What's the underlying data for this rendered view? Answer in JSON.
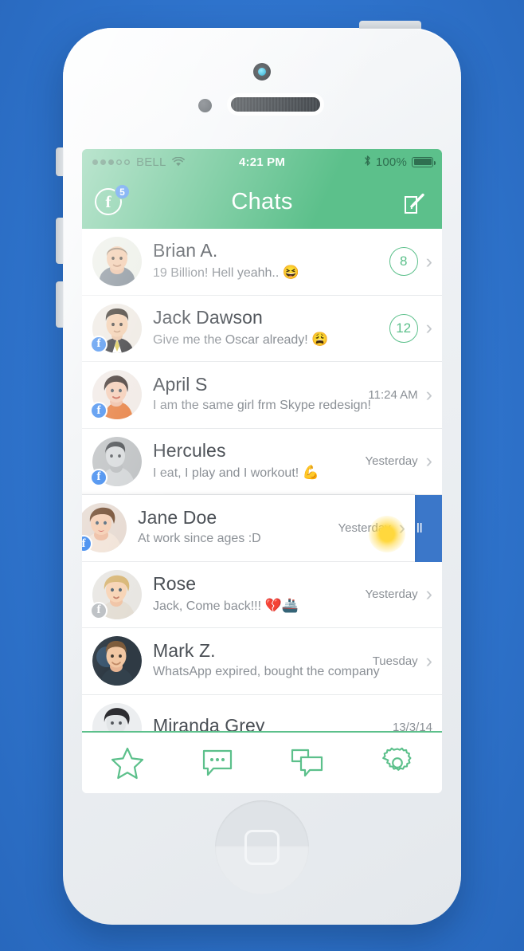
{
  "background": {
    "color": "#3176cf"
  },
  "device": {
    "name": "white-smartphone",
    "camera_lens_color": "#14a9cf",
    "body_color": "#eef1f4"
  },
  "theme": {
    "accent_green": "#5cc08b",
    "badge_blue": "#2f80ed",
    "action_blue": "#3b77c9",
    "text_primary": "#4a4f55",
    "text_secondary": "#8b9096"
  },
  "status_bar": {
    "signal_dots_filled": 3,
    "signal_dots_total": 5,
    "carrier": "BELL",
    "wifi_icon": "wifi-icon",
    "time": "4:21 PM",
    "bluetooth_icon": "bluetooth-icon",
    "battery_percent": "100%",
    "battery_icon": "battery-full-icon"
  },
  "nav_bar": {
    "facebook_button": {
      "icon": "facebook-icon",
      "glyph": "f",
      "count": "5"
    },
    "title": "Chats",
    "compose_button": {
      "icon": "compose-pencil-icon",
      "label": "Compose"
    }
  },
  "chats": [
    {
      "name": "Brian A.",
      "message": "19 Billion! Hell yeahh..",
      "emoji": "😆",
      "time": "",
      "unread": "8",
      "facebook_tag": "none",
      "avatar": "brian-avatar",
      "slid": false
    },
    {
      "name": "Jack Dawson",
      "message": "Give me the Oscar already!",
      "emoji": "😩",
      "time": "",
      "unread": "12",
      "facebook_tag": "blue",
      "avatar": "jack-avatar",
      "slid": false
    },
    {
      "name": "April S",
      "message": "I am the same girl frm Skype redesign!",
      "emoji": "",
      "time": "11:24 AM",
      "unread": "",
      "facebook_tag": "blue",
      "avatar": "april-avatar",
      "slid": false
    },
    {
      "name": "Hercules",
      "message": "I eat, I play and I workout!",
      "emoji": "💪",
      "time": "Yesterday",
      "unread": "",
      "facebook_tag": "blue",
      "avatar": "hercules-avatar",
      "slid": false
    },
    {
      "name": "Jane Doe",
      "message": "At work since ages :D",
      "emoji": "",
      "time": "Yesterday",
      "unread": "",
      "facebook_tag": "blue",
      "avatar": "jane-avatar",
      "slid": true,
      "action_label": "ll"
    },
    {
      "name": "Rose",
      "message": "Jack, Come back!!!",
      "emoji": "💔🚢",
      "time": "Yesterday",
      "unread": "",
      "facebook_tag": "grey",
      "avatar": "rose-avatar",
      "slid": false
    },
    {
      "name": "Mark Z.",
      "message": "WhatsApp expired, bought the company",
      "emoji": "",
      "time": "Tuesday",
      "unread": "",
      "facebook_tag": "none",
      "avatar": "mark-avatar",
      "slid": false
    },
    {
      "name": "Miranda Grey",
      "message": "",
      "emoji": "",
      "time": "13/3/14",
      "unread": "",
      "facebook_tag": "none",
      "avatar": "miranda-avatar",
      "slid": false
    }
  ],
  "chevron": "›",
  "tab_bar": {
    "items": [
      {
        "icon": "star-icon",
        "name": "favorites"
      },
      {
        "icon": "chat-bubble-icon",
        "name": "messages"
      },
      {
        "icon": "double-chat-icon",
        "name": "groups"
      },
      {
        "icon": "gear-icon",
        "name": "settings"
      }
    ]
  }
}
